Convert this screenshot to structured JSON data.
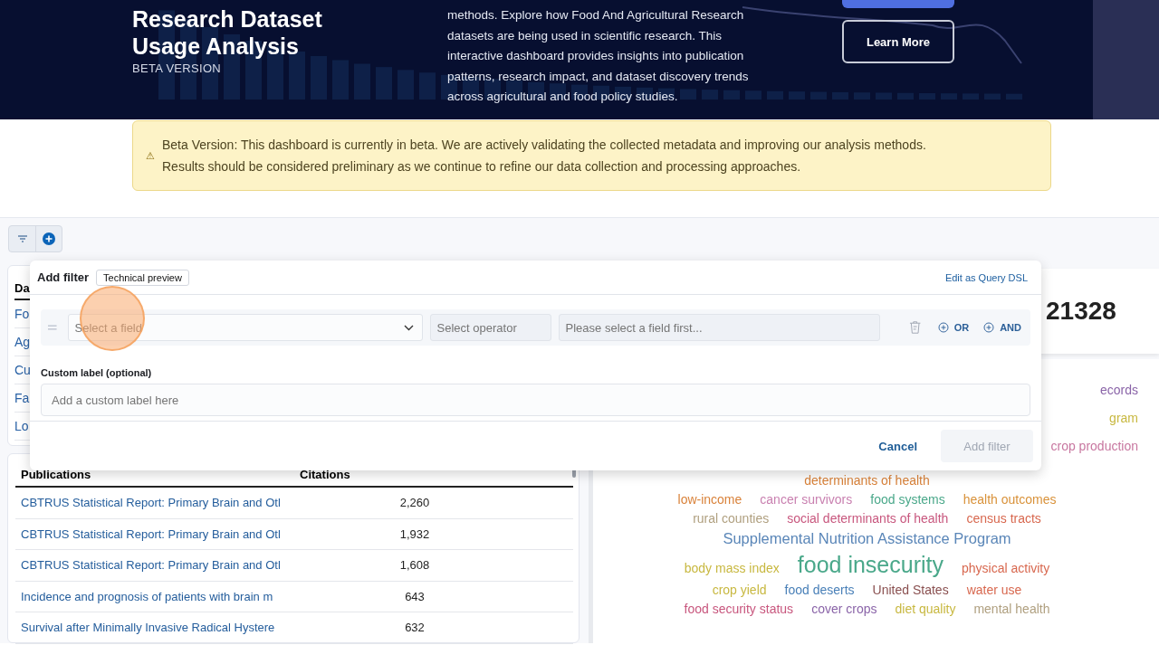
{
  "hero": {
    "title_lines": [
      "Research Dataset",
      "Usage Analysis"
    ],
    "subtitle": "BETA VERSION",
    "description_lines": [
      "methods. Explore how Food And Agricultural Research",
      "datasets are being used in scientific research. This",
      "interactive dashboard provides insights into publication",
      "patterns, research impact, and dataset discovery trends",
      "across agricultural and food policy studies."
    ],
    "button": "Learn More"
  },
  "banner": {
    "icon": "⚠",
    "lines": [
      "Beta Version: This dashboard is currently in beta. We are actively validating the collected metadata and improving our analysis methods.",
      "Results should be considered preliminary as we continue to refine our data collection and processing approaches."
    ]
  },
  "dataset_list": {
    "header": "Da",
    "items": [
      "Fo",
      "Ag",
      "Cu",
      "Fa",
      "Lo"
    ]
  },
  "table": {
    "columns": [
      "Publications",
      "Citations"
    ],
    "rows": [
      {
        "title": "CBTRUS Statistical Report: Primary Brain and Otl",
        "citations": "2,260"
      },
      {
        "title": "CBTRUS Statistical Report: Primary Brain and Otl",
        "citations": "1,932"
      },
      {
        "title": "CBTRUS Statistical Report: Primary Brain and Otl",
        "citations": "1,608"
      },
      {
        "title": "Incidence and prognosis of patients with brain m",
        "citations": "643"
      },
      {
        "title": "Survival after Minimally Invasive Radical Hystere",
        "citations": "632"
      }
    ]
  },
  "stat": {
    "value": "21328"
  },
  "cloud": {
    "edge_words": [
      {
        "text": "ecords",
        "color": "#8a64a8"
      },
      {
        "text": "gram",
        "color": "#c8b840"
      },
      {
        "text": "crop production",
        "color": "#c877a0"
      }
    ],
    "rows": [
      [
        {
          "text": "determinants of health",
          "color": "#d9823a",
          "kind": "small"
        }
      ],
      [
        {
          "text": "low-income",
          "color": "#d9823a",
          "kind": "small"
        },
        {
          "text": "cancer survivors",
          "color": "#c980b0",
          "kind": "small"
        },
        {
          "text": "food systems",
          "color": "#4aa88a",
          "kind": "small"
        },
        {
          "text": "health outcomes",
          "color": "#d9923a",
          "kind": "small"
        }
      ],
      [
        {
          "text": "rural counties",
          "color": "#b0a080",
          "kind": "small"
        },
        {
          "text": "social determinants of health",
          "color": "#c8577e",
          "kind": "small"
        },
        {
          "text": "census tracts",
          "color": "#d8684f",
          "kind": "small"
        }
      ],
      [
        {
          "text": "Supplemental Nutrition Assistance Program",
          "color": "#5a86b8",
          "kind": "medium"
        }
      ],
      [
        {
          "text": "body mass index",
          "color": "#c8b840",
          "kind": "small"
        },
        {
          "text": "food insecurity",
          "color": "#4aa88a",
          "kind": "large"
        },
        {
          "text": "physical activity",
          "color": "#d8684f",
          "kind": "small"
        }
      ],
      [
        {
          "text": "crop yield",
          "color": "#c8b840",
          "kind": "small"
        },
        {
          "text": "food deserts",
          "color": "#4a80b8",
          "kind": "small"
        },
        {
          "text": "United States",
          "color": "#8a5050",
          "kind": "small"
        },
        {
          "text": "water use",
          "color": "#d8684f",
          "kind": "small"
        }
      ],
      [
        {
          "text": "food security status",
          "color": "#c8577e",
          "kind": "small"
        },
        {
          "text": "cover crops",
          "color": "#8a64a8",
          "kind": "small"
        },
        {
          "text": "diet quality",
          "color": "#c8b840",
          "kind": "small"
        },
        {
          "text": "mental health",
          "color": "#b0a080",
          "kind": "small"
        }
      ]
    ]
  },
  "filter_popover": {
    "title": "Add filter",
    "badge": "Technical preview",
    "query_link": "Edit as Query DSL",
    "field_placeholder": "Select a field",
    "operator_placeholder": "Select operator",
    "value_placeholder": "Please select a field first...",
    "or_label": "OR",
    "and_label": "AND",
    "custom_label": "Custom label (optional)",
    "custom_placeholder": "Add a custom label here",
    "cancel": "Cancel",
    "submit": "Add filter",
    "submit_disabled": true
  }
}
